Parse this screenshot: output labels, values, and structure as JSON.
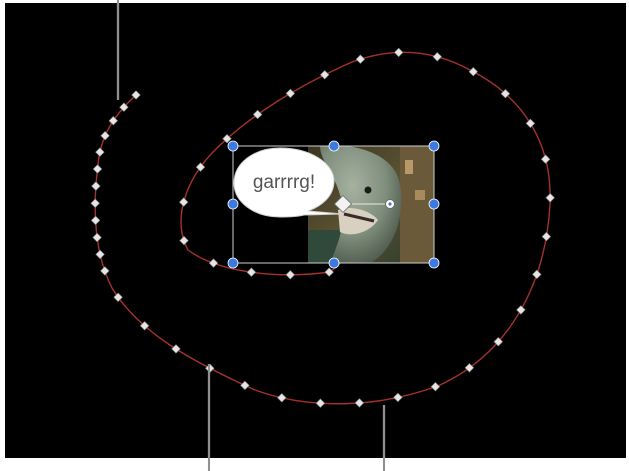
{
  "canvas": {
    "background_color": "#000000",
    "frame_color": "#ffffff"
  },
  "motion_path": {
    "stroke_color": "#a5312c",
    "keyframe_color": "#e6e6e6"
  },
  "object": {
    "speech_bubble_text": "garrrrg!",
    "image_description_icon": "moray-eel-photo",
    "handle_color": "#3c79e0"
  },
  "callouts": {
    "count": 3,
    "color": "#d9d9d9"
  }
}
